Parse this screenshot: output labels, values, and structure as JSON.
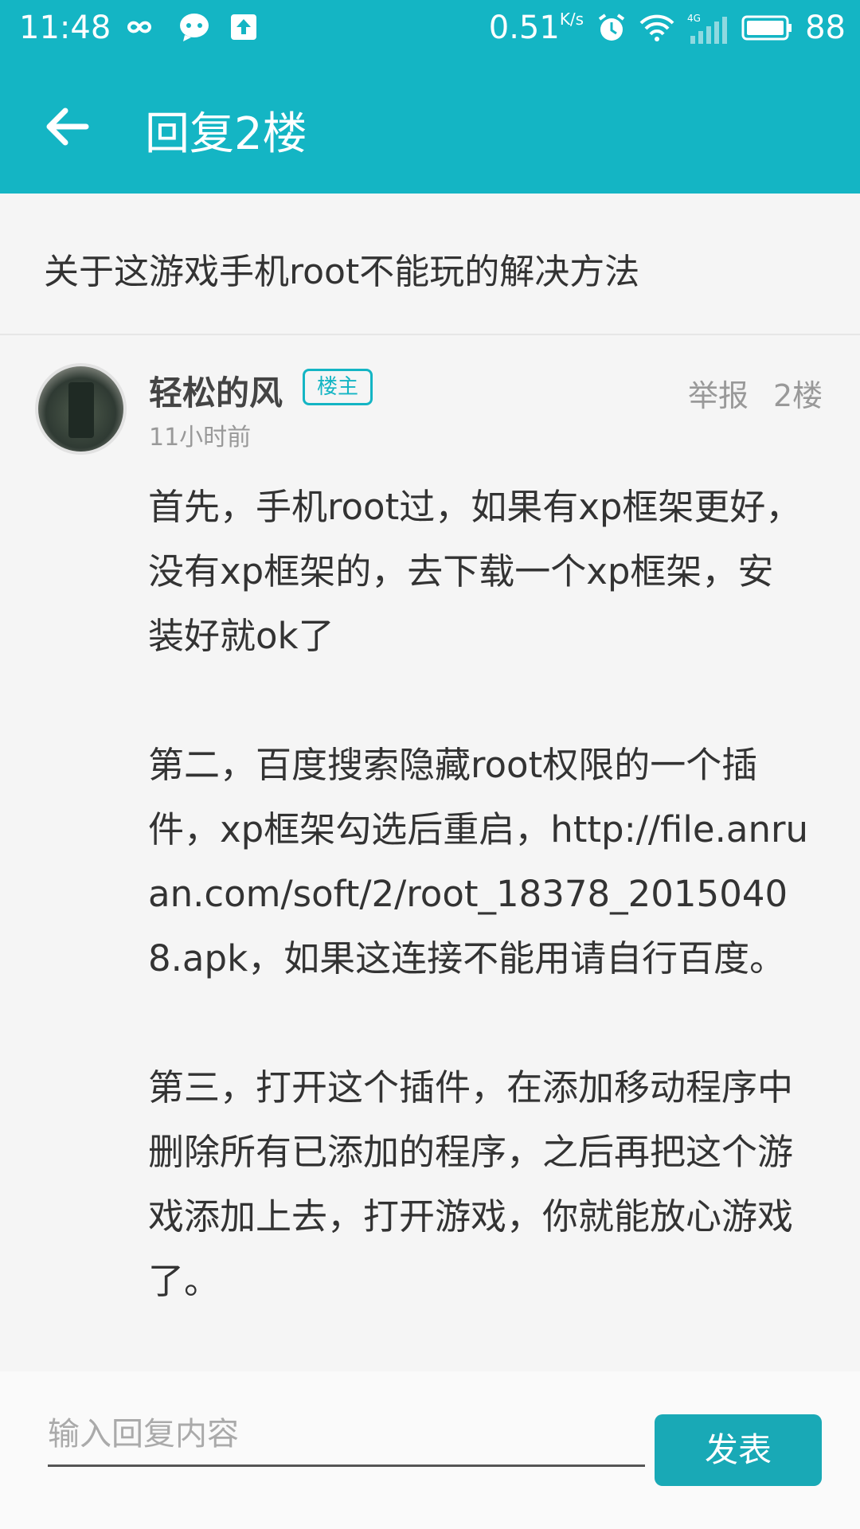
{
  "status_bar": {
    "time": "11:48",
    "speed": "0.51",
    "speed_unit": "K/s",
    "network": "4G",
    "battery": "88"
  },
  "app_bar": {
    "title": "回复2楼"
  },
  "topic": {
    "title": "关于这游戏手机root不能玩的解决方法"
  },
  "post": {
    "author": "轻松的风",
    "badge": "楼主",
    "time": "11小时前",
    "report": "举报",
    "floor": "2楼",
    "paragraphs": [
      "首先，手机root过，如果有xp框架更好，没有xp框架的，去下载一个xp框架，安装好就ok了",
      "第二，百度搜索隐藏root权限的一个插件，xp框架勾选后重启，http://file.anruan.com/soft/2/root_18378_20150408.apk，如果这连接不能用请自行百度。",
      "第三，打开这个插件，在添加移动程序中删除所有已添加的程序，之后再把这个游戏添加上去，打开游戏，你就能放心游戏了。"
    ]
  },
  "reply": {
    "placeholder": "输入回复内容",
    "send_label": "发表"
  },
  "colors": {
    "accent": "#14b5c4",
    "button": "#19a9b6"
  }
}
